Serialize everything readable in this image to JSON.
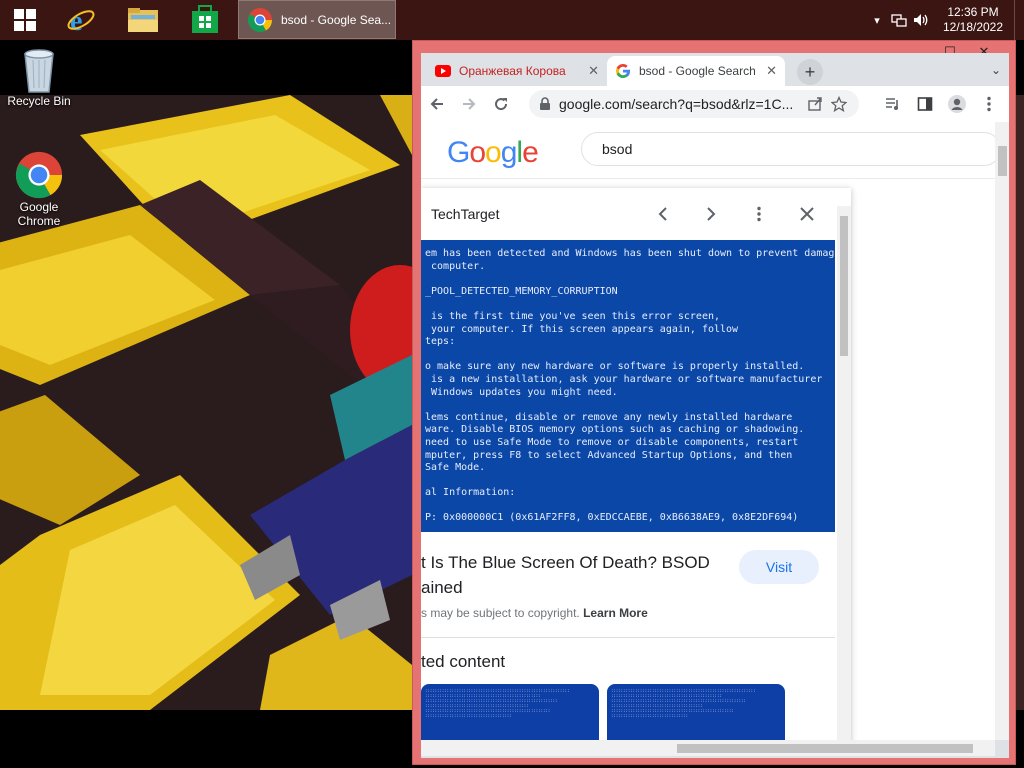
{
  "taskbar": {
    "start_icon": "windows-logo-icon",
    "pinned": [
      {
        "name": "internet-explorer",
        "icon": "internet-explorer-icon"
      },
      {
        "name": "file-explorer",
        "icon": "folder-icon"
      },
      {
        "name": "store",
        "icon": "store-icon"
      }
    ],
    "active_window_title": "bsod - Google Sea...",
    "tray": {
      "time": "12:36 PM",
      "date": "12/18/2022"
    }
  },
  "desktop": {
    "icons": [
      {
        "label": "Recycle Bin",
        "icon": "recycle-bin-icon"
      },
      {
        "label": "Google Chrome",
        "icon": "chrome-icon"
      }
    ]
  },
  "window": {
    "controls": {
      "minimize": "—",
      "maximize": "☐",
      "close": "✕"
    },
    "tabs": [
      {
        "title": "Оранжевая Корова",
        "icon": "youtube-icon",
        "active": false
      },
      {
        "title": "bsod - Google Search",
        "icon": "google-icon",
        "active": true
      }
    ],
    "new_tab": "+",
    "address": "google.com/search?q=bsod&rlz=1C..."
  },
  "page": {
    "logo": "Google",
    "query": "bsod",
    "panel": {
      "source": "TechTarget",
      "bsod_text": "em has been detected and Windows has been shut down to prevent damage\n computer.\n\n_POOL_DETECTED_MEMORY_CORRUPTION\n\n is the first time you've seen this error screen,\n your computer. If this screen appears again, follow\nteps:\n\no make sure any new hardware or software is properly installed.\n is a new installation, ask your hardware or software manufacturer\n Windows updates you might need.\n\nlems continue, disable or remove any newly installed hardware\nware. Disable BIOS memory options such as caching or shadowing.\nneed to use Safe Mode to remove or disable components, restart\nmputer, press F8 to select Advanced Startup Options, and then\nSafe Mode.\n\nal Information:\n\nP: 0x000000C1 (0x61AF2FF8, 0xEDCCAEBE, 0xB6638AE9, 0x8E2DF694)",
      "title_line1": "t Is The Blue Screen Of Death? BSOD",
      "title_line2": "ained",
      "visit": "Visit",
      "copyright": "s may be subject to copyright.",
      "learn_more": "Learn More",
      "related": "ted content"
    }
  },
  "colors": {
    "taskbar": "#3a1512",
    "window_frame": "#e57373",
    "bsod_blue": "#0b47a7",
    "link_blue": "#1a73e8"
  }
}
